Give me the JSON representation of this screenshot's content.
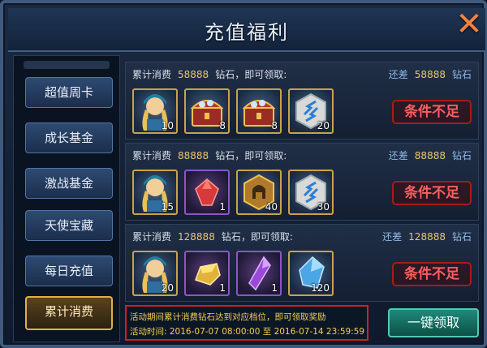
{
  "window": {
    "title": "充值福利"
  },
  "sidebar": {
    "items": [
      {
        "label": "超值周卡"
      },
      {
        "label": "成长基金"
      },
      {
        "label": "激战基金"
      },
      {
        "label": "天使宝藏"
      },
      {
        "label": "每日充值"
      },
      {
        "label": "累计消费",
        "active": true
      }
    ]
  },
  "rows": [
    {
      "cond_prefix": "累计消费",
      "cond_value": "58888",
      "cond_suffix": "钻石，即可领取:",
      "remain_prefix": "还差",
      "remain_value": "58888",
      "remain_suffix": "钻石",
      "items": [
        {
          "icon": "angel-portrait-icon",
          "count": "10"
        },
        {
          "icon": "treasure-chest-icon",
          "count": "8"
        },
        {
          "icon": "treasure-chest-icon",
          "count": "8"
        },
        {
          "icon": "rune-stone-icon",
          "count": "20"
        }
      ],
      "status": "条件不足"
    },
    {
      "cond_prefix": "累计消费",
      "cond_value": "88888",
      "cond_suffix": "钻石，即可领取:",
      "remain_prefix": "还差",
      "remain_value": "88888",
      "remain_suffix": "钻石",
      "items": [
        {
          "icon": "angel-portrait-icon",
          "count": "15"
        },
        {
          "icon": "red-gem-icon",
          "count": "1"
        },
        {
          "icon": "helmet-medal-icon",
          "count": "40"
        },
        {
          "icon": "rune-stone-icon",
          "count": "30"
        }
      ],
      "status": "条件不足"
    },
    {
      "cond_prefix": "累计消费",
      "cond_value": "128888",
      "cond_suffix": "钻石，即可领取:",
      "remain_prefix": "还差",
      "remain_value": "128888",
      "remain_suffix": "钻石",
      "items": [
        {
          "icon": "angel-portrait-icon",
          "count": "20"
        },
        {
          "icon": "gold-ingot-icon",
          "count": "1"
        },
        {
          "icon": "purple-crystal-icon",
          "count": "1"
        },
        {
          "icon": "blue-crystal-icon",
          "count": "120"
        }
      ],
      "status": "条件不足"
    }
  ],
  "footer": {
    "line1": "活动期间累计消费钻石达到对应档位，即可领取奖励",
    "line2": "活动时间: 2016-07-07 08:00:00  至  2016-07-14 23:59:59",
    "claim_all": "一键领取"
  },
  "colors": {
    "accent_gold": "#e6c76b",
    "status_red": "#ff5e5e",
    "claim_teal": "#1e8a7b"
  }
}
